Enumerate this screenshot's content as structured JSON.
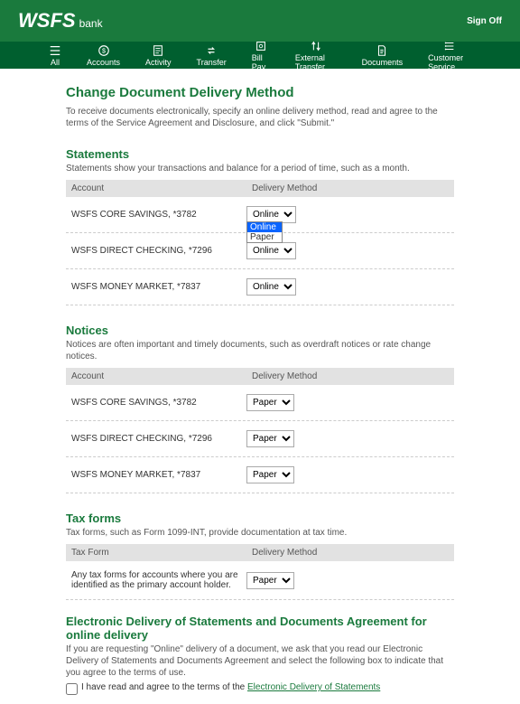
{
  "header": {
    "logo_main": "WSFS",
    "logo_sub": "bank",
    "signoff": "Sign Off"
  },
  "nav": {
    "all": "All",
    "accounts": "Accounts",
    "activity": "Activity",
    "transfer": "Transfer",
    "billpay": "Bill Pay",
    "external": "External Transfer",
    "documents": "Documents",
    "customer": "Customer Service"
  },
  "page": {
    "title": "Change Document Delivery Method",
    "intro": "To receive documents electronically, specify an online delivery method, read and agree to the terms of the Service Agreement and Disclosure, and click \"Submit.\""
  },
  "columns": {
    "account": "Account",
    "taxform": "Tax Form",
    "method": "Delivery Method"
  },
  "statements": {
    "title": "Statements",
    "desc": "Statements show your transactions and balance for a period of time, such as a month.",
    "rows": [
      {
        "acct": "WSFS CORE SAVINGS, *3782",
        "method": "Online"
      },
      {
        "acct": "WSFS DIRECT CHECKING, *7296",
        "method": "Online"
      },
      {
        "acct": "WSFS MONEY MARKET, *7837",
        "method": "Online"
      }
    ],
    "dropdown": {
      "opt1": "Online",
      "opt2": "Paper"
    }
  },
  "notices": {
    "title": "Notices",
    "desc": "Notices are often important and timely documents, such as overdraft notices or rate change notices.",
    "rows": [
      {
        "acct": "WSFS CORE SAVINGS, *3782",
        "method": "Paper"
      },
      {
        "acct": "WSFS DIRECT CHECKING, *7296",
        "method": "Paper"
      },
      {
        "acct": "WSFS MONEY MARKET, *7837",
        "method": "Paper"
      }
    ]
  },
  "tax": {
    "title": "Tax forms",
    "desc": "Tax forms, such as Form 1099-INT, provide documentation at tax time.",
    "row_desc": "Any tax forms for accounts where you are identified as the primary account holder.",
    "method": "Paper"
  },
  "agreement": {
    "title": "Electronic Delivery of Statements and Documents Agreement for online delivery",
    "text": "If you are requesting \"Online\" delivery of a document, we ask that you read our Electronic Delivery of Statements and Documents Agreement and select the following box to indicate that you agree to the terms of use.",
    "check_text": "I have read and agree to the terms of the ",
    "link": "Electronic Delivery of Statements"
  }
}
